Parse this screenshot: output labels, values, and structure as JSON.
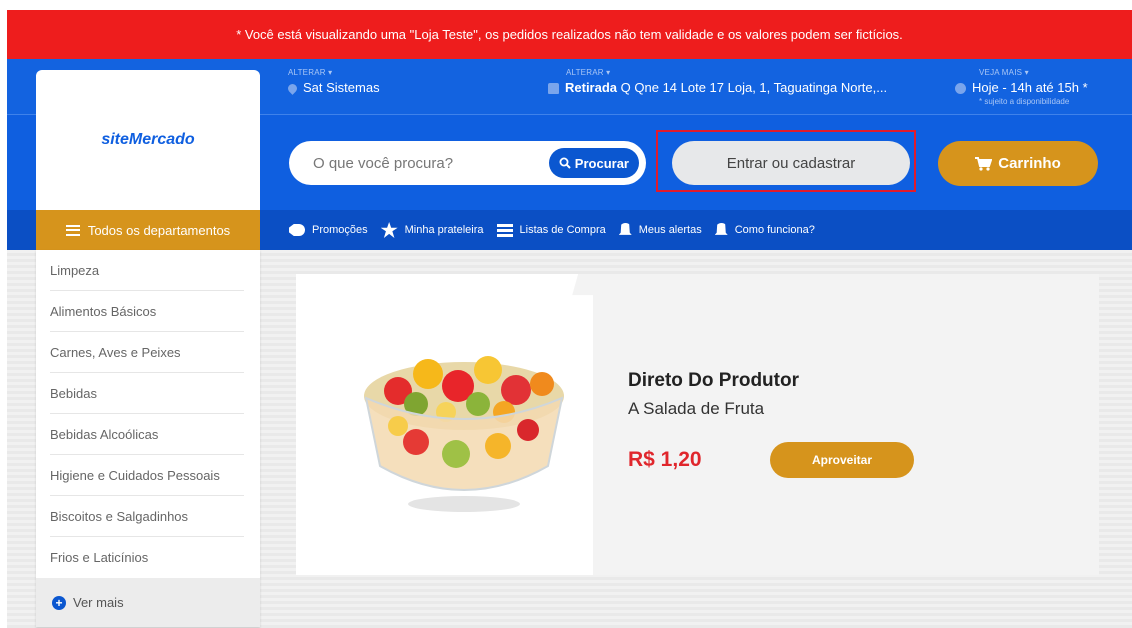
{
  "notice": "* Você está visualizando uma \"Loja Teste\", os pedidos realizados não tem validade e os valores podem ser fictícios.",
  "brand": {
    "logo_text": "siteMercado"
  },
  "header": {
    "store": {
      "small": "ALTERAR",
      "value": "Sat Sistemas"
    },
    "pickup": {
      "small": "ALTERAR",
      "label": "Retirada",
      "address": "Q Qne 14 Lote 17 Loja, 1, Taguatinga Norte,..."
    },
    "schedule": {
      "small": "VEJA MAIS",
      "value": "Hoje - 14h até 15h *",
      "note": "* sujeito a disponibilidade"
    }
  },
  "search": {
    "placeholder": "O que você procura?",
    "button": "Procurar"
  },
  "login_button": "Entrar ou cadastrar",
  "cart_button": "Carrinho",
  "nav": {
    "departments": "Todos os departamentos",
    "links": [
      {
        "label": "Promoções",
        "icon": "tag-icon"
      },
      {
        "label": "Minha prateleira",
        "icon": "star-icon"
      },
      {
        "label": "Listas de Compra",
        "icon": "list-icon"
      },
      {
        "label": "Meus alertas",
        "icon": "bell-icon"
      },
      {
        "label": "Como funciona?",
        "icon": "bell-icon"
      }
    ]
  },
  "sidebar": {
    "items": [
      "Limpeza",
      "Alimentos Básicos",
      "Carnes, Aves e Peixes",
      "Bebidas",
      "Bebidas Alcoólicas",
      "Higiene e Cuidados Pessoais",
      "Biscoitos e Salgadinhos",
      "Frios e Laticínios"
    ],
    "more": "Ver mais"
  },
  "promo": {
    "title": "Direto Do Produtor",
    "subtitle": "A Salada de Fruta",
    "price": "R$ 1,20",
    "button": "Aproveitar"
  },
  "colors": {
    "red": "#ee1d1d",
    "blue": "#0f5fe0",
    "gold": "#d6941c",
    "price": "#e0262c"
  }
}
